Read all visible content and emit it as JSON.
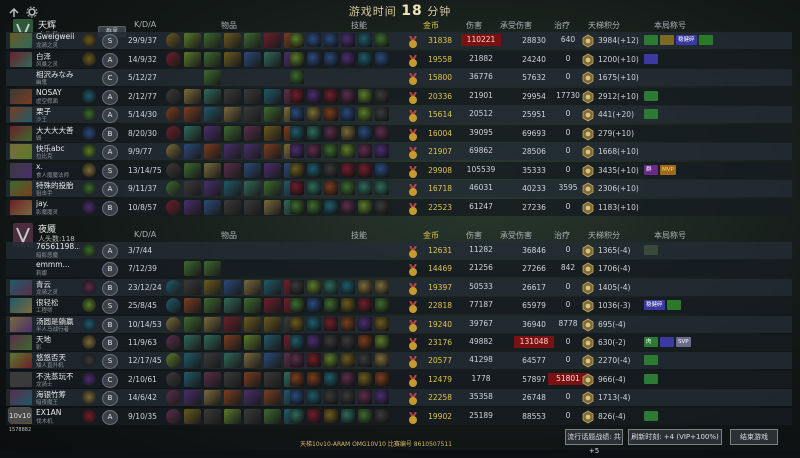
{
  "header": {
    "timer_prefix": "游戏时间",
    "timer_value": "18",
    "timer_suffix": "分钟"
  },
  "columns": {
    "kda": "K/D/A",
    "items": "物品",
    "skills": "技能",
    "gold": "金币",
    "damage": "伤害",
    "taken": "承受伤害",
    "heal": "治疗",
    "ladder": "天梯积分",
    "title": "本局称号"
  },
  "columns2": {
    "damage": "伤害",
    "taken": "承受伤害",
    "heal": "治疗"
  },
  "team1": {
    "name": "天辉",
    "kills_label": "人头数:",
    "kills": "105",
    "friend_btn": "群里"
  },
  "team2": {
    "name": "夜魇",
    "kills_label": "人头数:",
    "kills": "118"
  },
  "players1": [
    {
      "name": "Gweigweii",
      "sub": "龙骑之灵",
      "lvl": "S",
      "kda": "29/9/37",
      "gold": "31838",
      "dmg": "110221",
      "taken": "28830",
      "heal": "640",
      "score": "3984(+12)",
      "hl": "dmg",
      "badges": [
        [
          "#2d7a35",
          ""
        ],
        [
          "#7a6b20",
          ""
        ],
        [
          "#3a3aa0",
          "稳健碎"
        ],
        [
          "#2a7a2a",
          ""
        ]
      ]
    },
    {
      "name": "白泽",
      "sub": "风暴之灵",
      "lvl": "A",
      "kda": "14/9/32",
      "gold": "19558",
      "dmg": "21882",
      "taken": "24240",
      "heal": "0",
      "score": "1200(+10)",
      "badges": [
        [
          "#3a3aa0",
          ""
        ]
      ]
    },
    {
      "name": "相沢みなみ",
      "sub": "幽鬼",
      "lvl": "C",
      "kda": "5/12/27",
      "gold": "15800",
      "dmg": "36776",
      "taken": "57632",
      "heal": "0",
      "score": "1675(+10)",
      "badges": []
    },
    {
      "name": "NOSAY",
      "sub": "虚空假面",
      "lvl": "A",
      "kda": "2/12/77",
      "gold": "20336",
      "dmg": "21901",
      "taken": "29954",
      "heal": "17730",
      "score": "2912(+10)",
      "badges": [
        [
          "#2d7a35",
          ""
        ]
      ]
    },
    {
      "name": "栗子",
      "sub": "沙王",
      "lvl": "A",
      "kda": "5/14/30",
      "gold": "15614",
      "dmg": "20512",
      "taken": "25951",
      "heal": "0",
      "score": "441(+20)",
      "badges": [
        [
          "#2d7a35",
          ""
        ]
      ]
    },
    {
      "name": "大大大大善",
      "sub": "毁",
      "lvl": "B",
      "kda": "8/20/30",
      "gold": "16004",
      "dmg": "39095",
      "taken": "69693",
      "heal": "0",
      "score": "279(+10)",
      "badges": []
    },
    {
      "name": "快乐abc",
      "sub": "拉比克",
      "lvl": "A",
      "kda": "9/9/77",
      "gold": "21907",
      "dmg": "69862",
      "taken": "28506",
      "heal": "0",
      "score": "1668(+10)",
      "badges": []
    },
    {
      "name": "x.",
      "sub": "食人魔魔法师",
      "lvl": "S",
      "kda": "13/14/75",
      "gold": "29908",
      "dmg": "105539",
      "taken": "35333",
      "heal": "0",
      "score": "3435(+10)",
      "badges": [
        [
          "#6a2a8a",
          "群"
        ],
        [
          "#a06a1a",
          "MVP"
        ]
      ]
    },
    {
      "name": "特殊的投胎",
      "sub": "狙击手",
      "lvl": "A",
      "kda": "9/11/37",
      "gold": "16718",
      "dmg": "46031",
      "taken": "40233",
      "heal": "3595",
      "score": "2306(+10)",
      "badges": []
    },
    {
      "name": "jay.",
      "sub": "影魔魔灵",
      "lvl": "B",
      "kda": "10/8/57",
      "gold": "22523",
      "dmg": "61247",
      "taken": "27236",
      "heal": "0",
      "score": "1183(+10)",
      "badges": []
    }
  ],
  "players2": [
    {
      "name": "76561198...",
      "sub": "暗影恶魔",
      "lvl": "A",
      "kda": "3/7/44",
      "gold": "12631",
      "dmg": "11282",
      "taken": "36846",
      "heal": "0",
      "score": "1365(-4)",
      "badges": [
        [
          "#3a4a3a",
          ""
        ]
      ]
    },
    {
      "name": "emmm...",
      "sub": "莉娜",
      "lvl": "B",
      "kda": "7/12/39",
      "gold": "14469",
      "dmg": "21256",
      "taken": "27266",
      "heal": "842",
      "score": "1706(-4)",
      "badges": []
    },
    {
      "name": "青云",
      "sub": "龙骑之灵",
      "lvl": "B",
      "kda": "23/12/24",
      "gold": "19397",
      "dmg": "50533",
      "taken": "26617",
      "heal": "0",
      "score": "1405(-4)",
      "badges": []
    },
    {
      "name": "很轻松",
      "sub": "工程师",
      "lvl": "S",
      "kda": "25/8/45",
      "gold": "22818",
      "dmg": "77187",
      "taken": "65979",
      "heal": "0",
      "score": "1036(-3)",
      "badges": [
        [
          "#3a3aa0",
          "稳健碎"
        ],
        [
          "#2a7a2a",
          ""
        ]
      ]
    },
    {
      "name": "汤圆是躺赢",
      "sub": "半人马战行者",
      "lvl": "B",
      "kda": "10/14/53",
      "gold": "19240",
      "dmg": "39767",
      "taken": "36940",
      "heal": "8778",
      "score": "695(-4)",
      "badges": []
    },
    {
      "name": "天地",
      "sub": "影",
      "lvl": "B",
      "kda": "11/9/63",
      "gold": "23176",
      "dmg": "49882",
      "taken": "131048",
      "heal": "0",
      "score": "630(-2)",
      "hl": "taken",
      "badges": [
        [
          "#2d7a35",
          "肉"
        ],
        [
          "#3a3aa0",
          ""
        ],
        [
          "#6a6a8a",
          "SVP"
        ]
      ]
    },
    {
      "name": "悠悠否天",
      "sub": "矮人直升机",
      "lvl": "S",
      "kda": "12/17/45",
      "gold": "20577",
      "dmg": "41298",
      "taken": "64577",
      "heal": "0",
      "score": "2270(-4)",
      "badges": [
        [
          "#2d7a35",
          ""
        ]
      ]
    },
    {
      "name": "不洗蒸玩不",
      "sub": "龙骑士",
      "lvl": "C",
      "kda": "2/10/61",
      "gold": "12479",
      "dmg": "1778",
      "taken": "57897",
      "heal": "51801",
      "score": "966(-4)",
      "hl": "heal",
      "badges": [
        [
          "#2d7a35",
          ""
        ]
      ]
    },
    {
      "name": "海银竹筹",
      "sub": "暗夜魔王",
      "lvl": "B",
      "kda": "14/6/42",
      "gold": "22258",
      "dmg": "35358",
      "taken": "26748",
      "heal": "0",
      "score": "1713(-4)",
      "badges": []
    },
    {
      "name": "EX1AN",
      "sub": "伐木机",
      "lvl": "A",
      "kda": "9/10/35",
      "gold": "19902",
      "dmg": "25189",
      "taken": "88553",
      "heal": "0",
      "score": "826(-4)",
      "badges": [
        [
          "#2d7a35",
          ""
        ]
      ]
    }
  ],
  "footer": {
    "match_text": "天梯10v10-ARAM  OMG10V10 比赛编号 8610507511",
    "btn_share": "流行话题战绩: 共 +5",
    "btn_refresh": "刷新时刻: +4 (VIP+100%)",
    "btn_exit": "结束游戏"
  },
  "logo": {
    "text": "10v10",
    "sub": "1578882"
  },
  "colors": {
    "gold": "#e2c44d",
    "highlight": "#7a1212",
    "team_bar": "#223038"
  },
  "icons": {
    "back": "back-arrow-icon",
    "settings": "gear-icon"
  }
}
